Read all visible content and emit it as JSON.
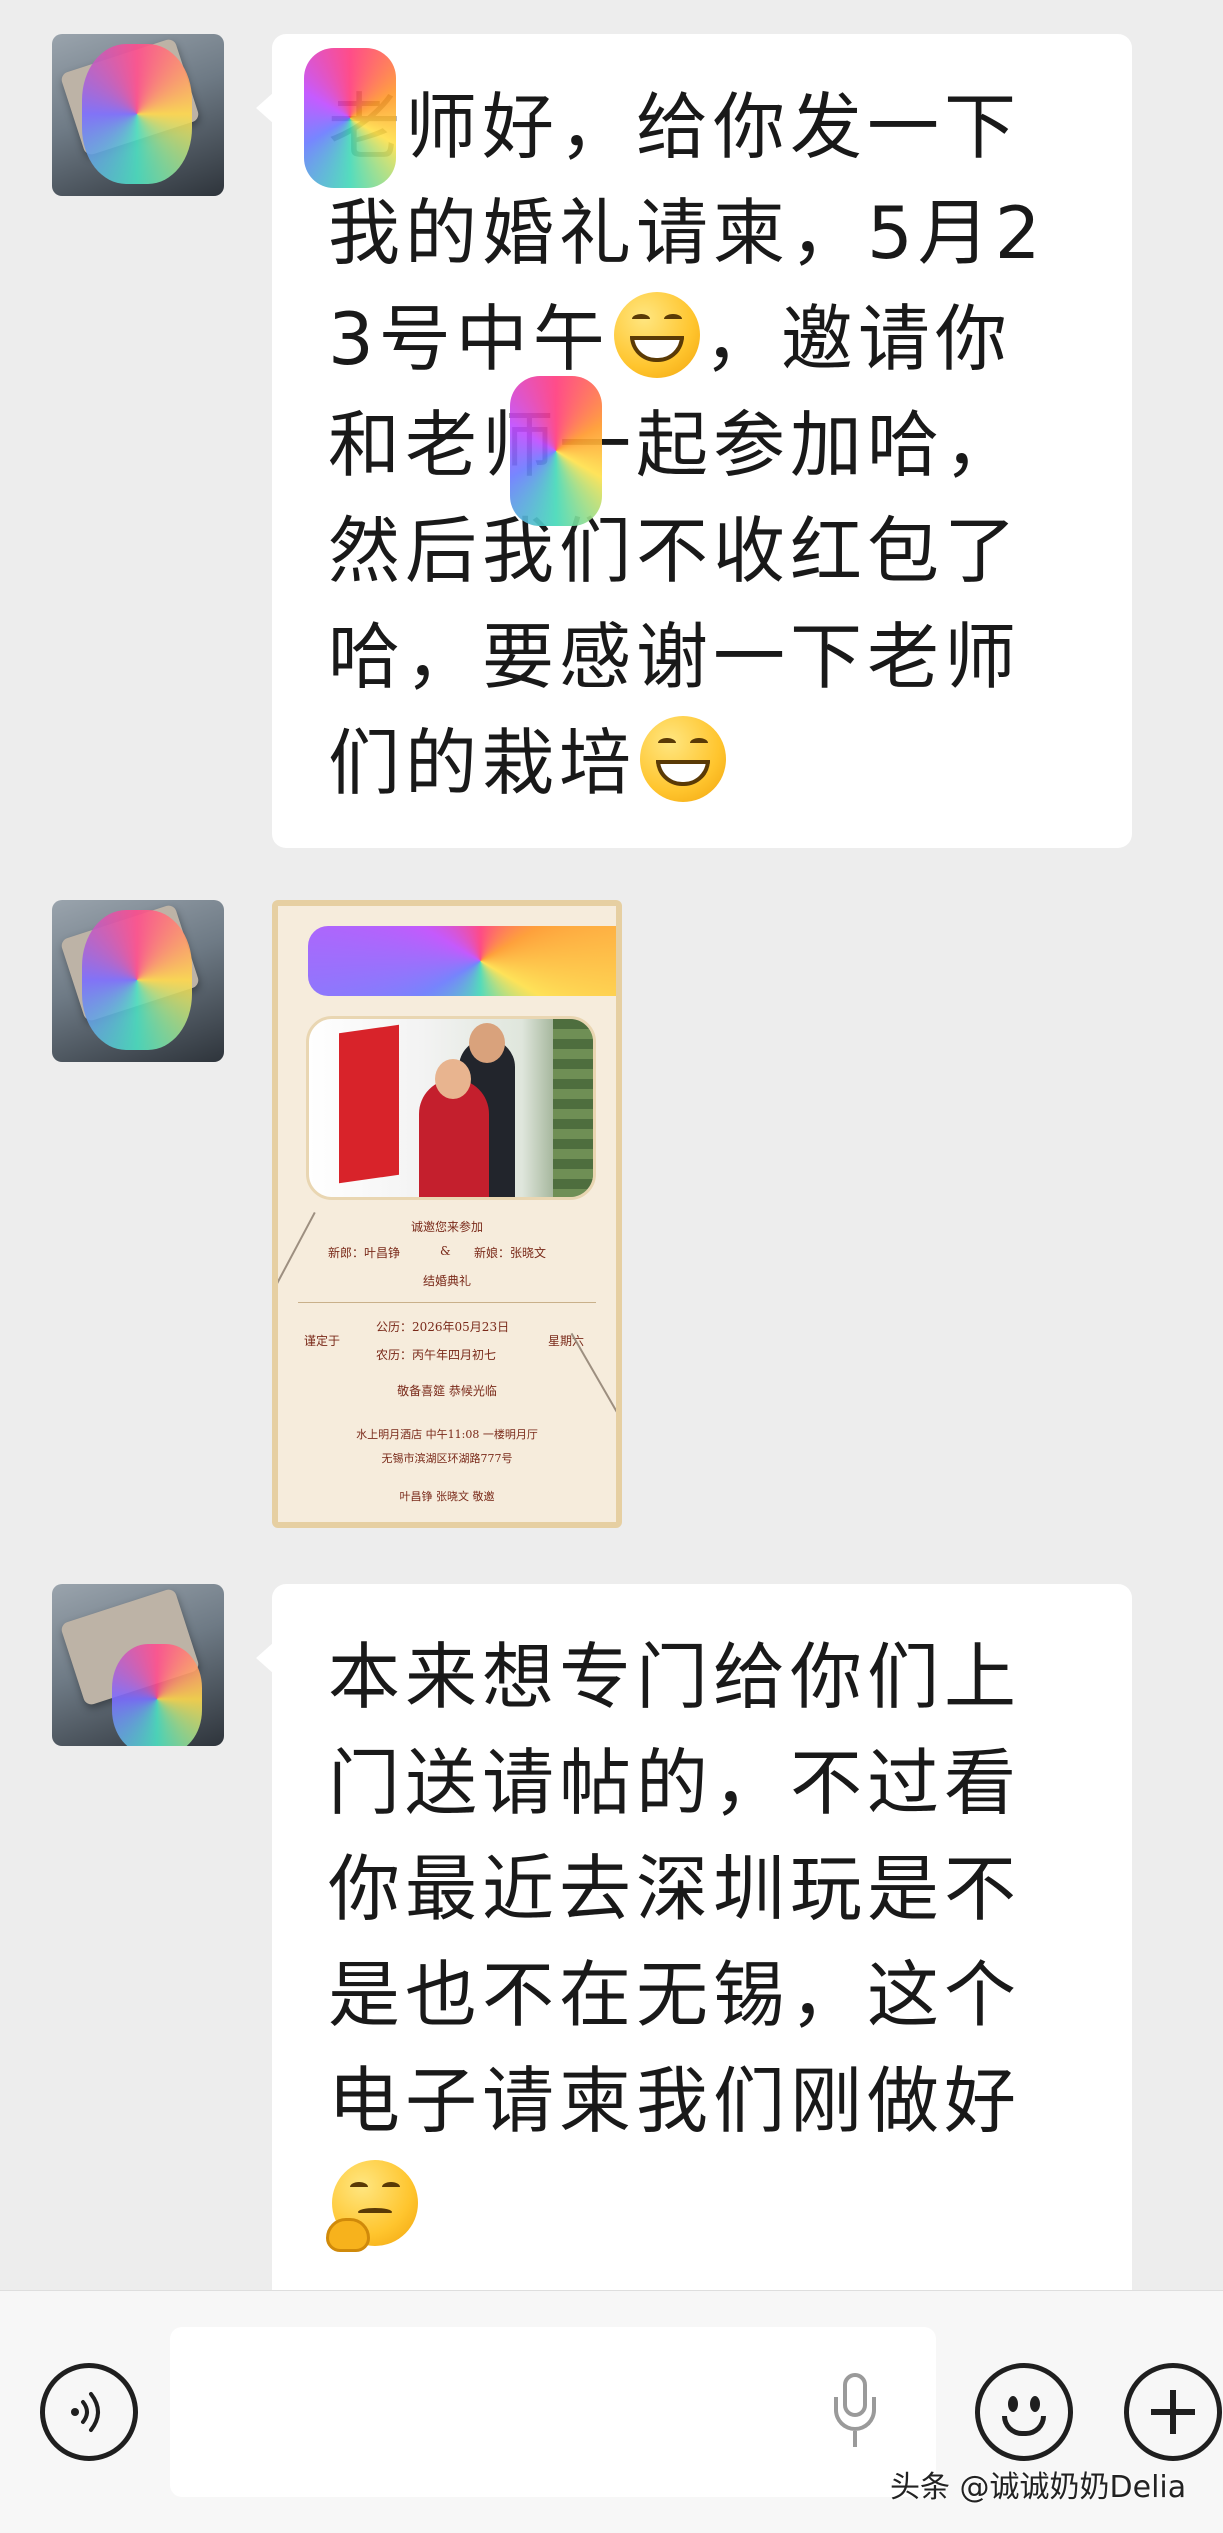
{
  "messages": [
    {
      "type": "text",
      "lines_before_emoji1": "老师好，给你发一下我的婚礼请柬，5月23号中午",
      "lines_middle": "，邀请你和",
      "lines_after_redact": "老师一起参加哈，然后我们不收红包了哈，要感谢一下老师们的栽培",
      "emojis": [
        "grin-emoji",
        "grin-emoji"
      ]
    },
    {
      "type": "image",
      "invitation": {
        "invite_text": "诚邀您来参加",
        "groom": "新郎：叶昌铮",
        "amp": "&",
        "bride": "新娘：张晓文",
        "ceremony": "结婚典礼",
        "fixed_on": "谨定于",
        "solar": "公历：2026年05月23日",
        "weekday": "星期六",
        "lunar": "农历：丙午年四月初七",
        "banquet": "敬备喜筵 恭候光临",
        "venue": "水上明月酒店 中午11:08 一楼明月厅",
        "address": "无锡市滨湖区环湖路777号",
        "hosts": "叶昌铮 张晓文 敬邀"
      }
    },
    {
      "type": "text",
      "text": "本来想专门给你们上门送请帖的，不过看你最近去深圳玩是不是也不在无锡，这个电子请柬我们刚做好",
      "emoji": "thinking-emoji"
    }
  ],
  "input_bar": {
    "placeholder": "",
    "icons": [
      "voice-icon",
      "mic-icon",
      "emoji-icon",
      "plus-icon"
    ]
  },
  "watermark": "头条 @诚诚奶奶Delia"
}
